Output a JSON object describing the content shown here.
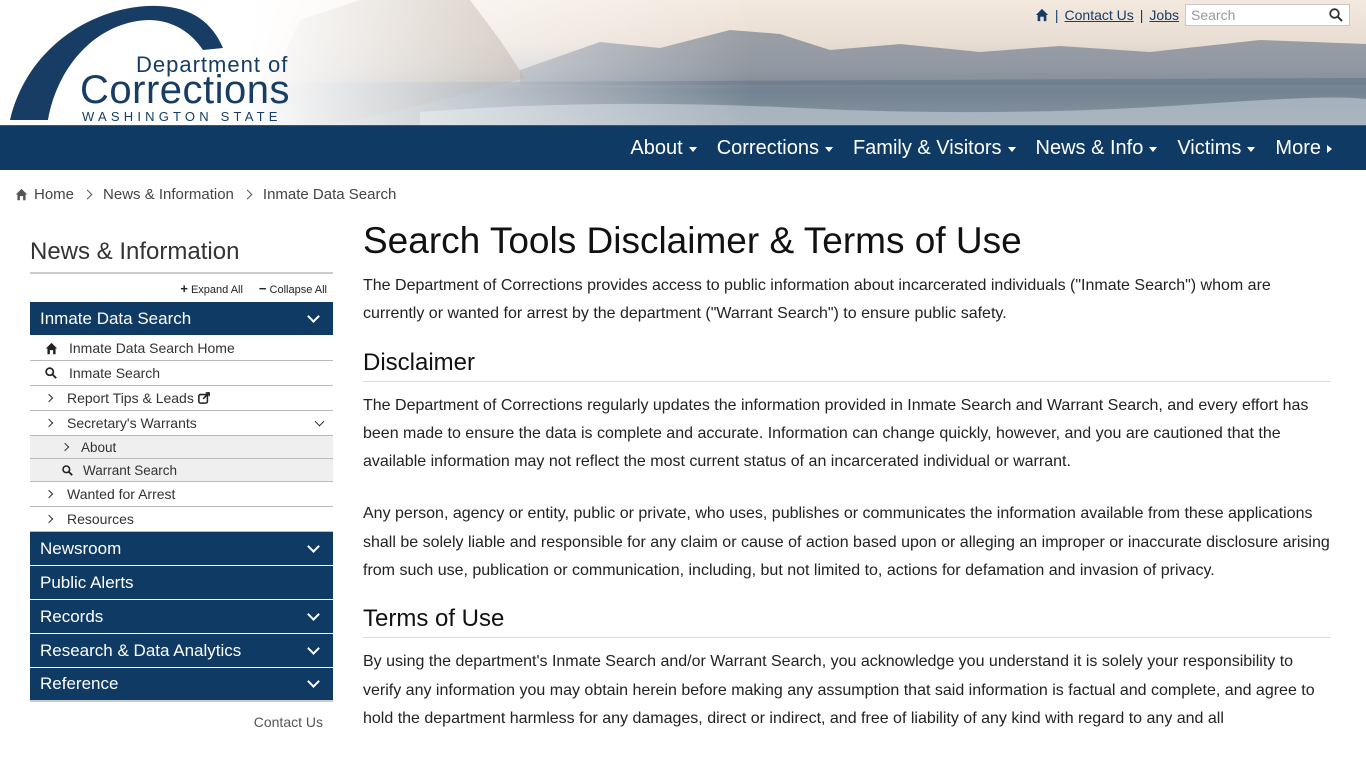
{
  "header": {
    "logo": {
      "line1": "Department of",
      "line2": "Corrections",
      "line3": "WASHINGTON STATE"
    },
    "utility": {
      "contact": "Contact Us",
      "jobs": "Jobs",
      "search_placeholder": "Search"
    }
  },
  "nav": {
    "items": [
      {
        "label": "About",
        "icon": "caret-down"
      },
      {
        "label": "Corrections",
        "icon": "caret-down"
      },
      {
        "label": "Family & Visitors",
        "icon": "caret-down"
      },
      {
        "label": "News & Info",
        "icon": "caret-down"
      },
      {
        "label": "Victims",
        "icon": "caret-down"
      },
      {
        "label": "More",
        "icon": "caret-right"
      }
    ]
  },
  "breadcrumb": [
    "Home",
    "News & Information",
    "Inmate Data Search"
  ],
  "sidebar": {
    "title": "News & Information",
    "expand_all": "Expand All",
    "collapse_all": "Collapse All",
    "active_section": "Inmate Data Search",
    "items": [
      {
        "label": "Inmate Data Search Home",
        "icon": "home-icon"
      },
      {
        "label": "Inmate Search",
        "icon": "search-icon"
      },
      {
        "label": "Report Tips & Leads",
        "icon": "chevron-right-icon"
      },
      {
        "label": "Secretary's Warrants",
        "icon": "chevron-right-icon"
      },
      {
        "label": "About",
        "icon": "chevron-right-icon"
      },
      {
        "label": "Warrant Search",
        "icon": "search-icon"
      },
      {
        "label": "Wanted for Arrest",
        "icon": "chevron-right-icon"
      },
      {
        "label": "Resources",
        "icon": "chevron-right-icon"
      }
    ],
    "sections": [
      "Newsroom",
      "Public Alerts",
      "Records",
      "Research & Data Analytics",
      "Reference"
    ],
    "contact": "Contact Us"
  },
  "main": {
    "title": "Search Tools Disclaimer & Terms of Use",
    "intro": "The Department of Corrections provides access to public information about incarcerated individuals (\"Inmate Search\") whom are currently or wanted for arrest by the department (\"Warrant Search\") to ensure public safety.",
    "disclaimer_heading": "Disclaimer",
    "disclaimer_p1": "The Department of Corrections regularly updates the information provided in Inmate Search and Warrant Search, and every effort has been made to ensure the data is complete and accurate. Information can change quickly, however, and you are cautioned that the available information may not reflect the most current status of an incarcerated individual or warrant.",
    "disclaimer_p2": "Any person, agency or entity, public or private, who uses, publishes or communicates the information available from these applications shall be solely liable and responsible for any claim or cause of action based upon or alleging an improper or inaccurate disclosure arising from such use, publication or communication, including, but not limited to, actions for defamation and invasion of privacy.",
    "terms_heading": "Terms of Use",
    "terms_p1": "By using the department's Inmate Search and/or Warrant Search, you acknowledge you understand it is solely your responsibility to verify any information you may obtain herein before making any assumption that said information is factual and complete, and agree to hold the department harmless for any damages, direct or indirect, and free of liability of any kind with regard to any and all"
  },
  "colors": {
    "navy": "#0e3a63",
    "logo_blue": "#173d64"
  }
}
